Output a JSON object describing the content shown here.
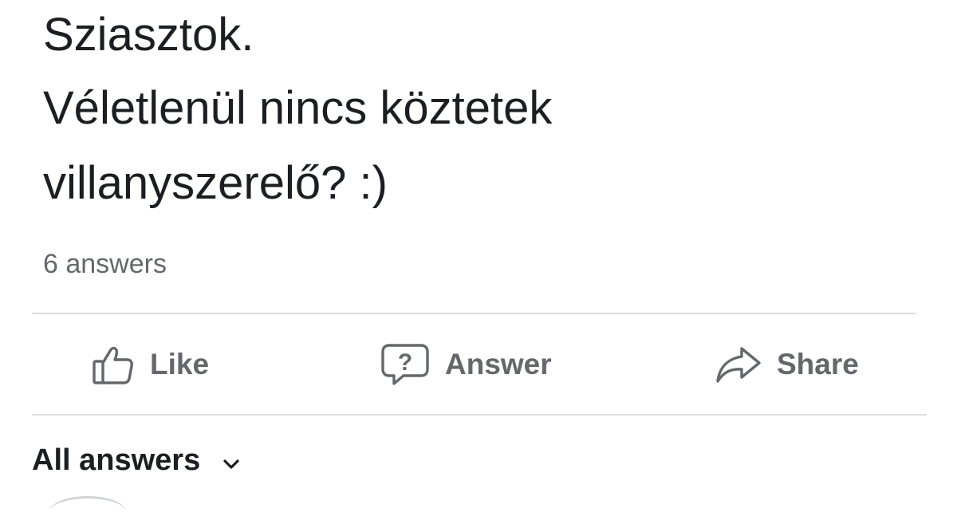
{
  "post": {
    "lines": [
      "Sziasztok.",
      "Véletlenül nincs köztetek",
      "villanyszerelő? :)"
    ],
    "answer_count": "6 answers"
  },
  "actions": {
    "like": {
      "label": "Like",
      "icon": "thumbs-up-icon"
    },
    "answer": {
      "label": "Answer",
      "icon": "question-bubble-icon"
    },
    "share": {
      "label": "Share",
      "icon": "share-arrow-icon"
    }
  },
  "answers_section": {
    "label": "All answers",
    "icon": "chevron-down-icon"
  },
  "colors": {
    "text": "#1c1e21",
    "muted": "#65676b",
    "divider": "#dadde1",
    "background": "#ffffff"
  }
}
